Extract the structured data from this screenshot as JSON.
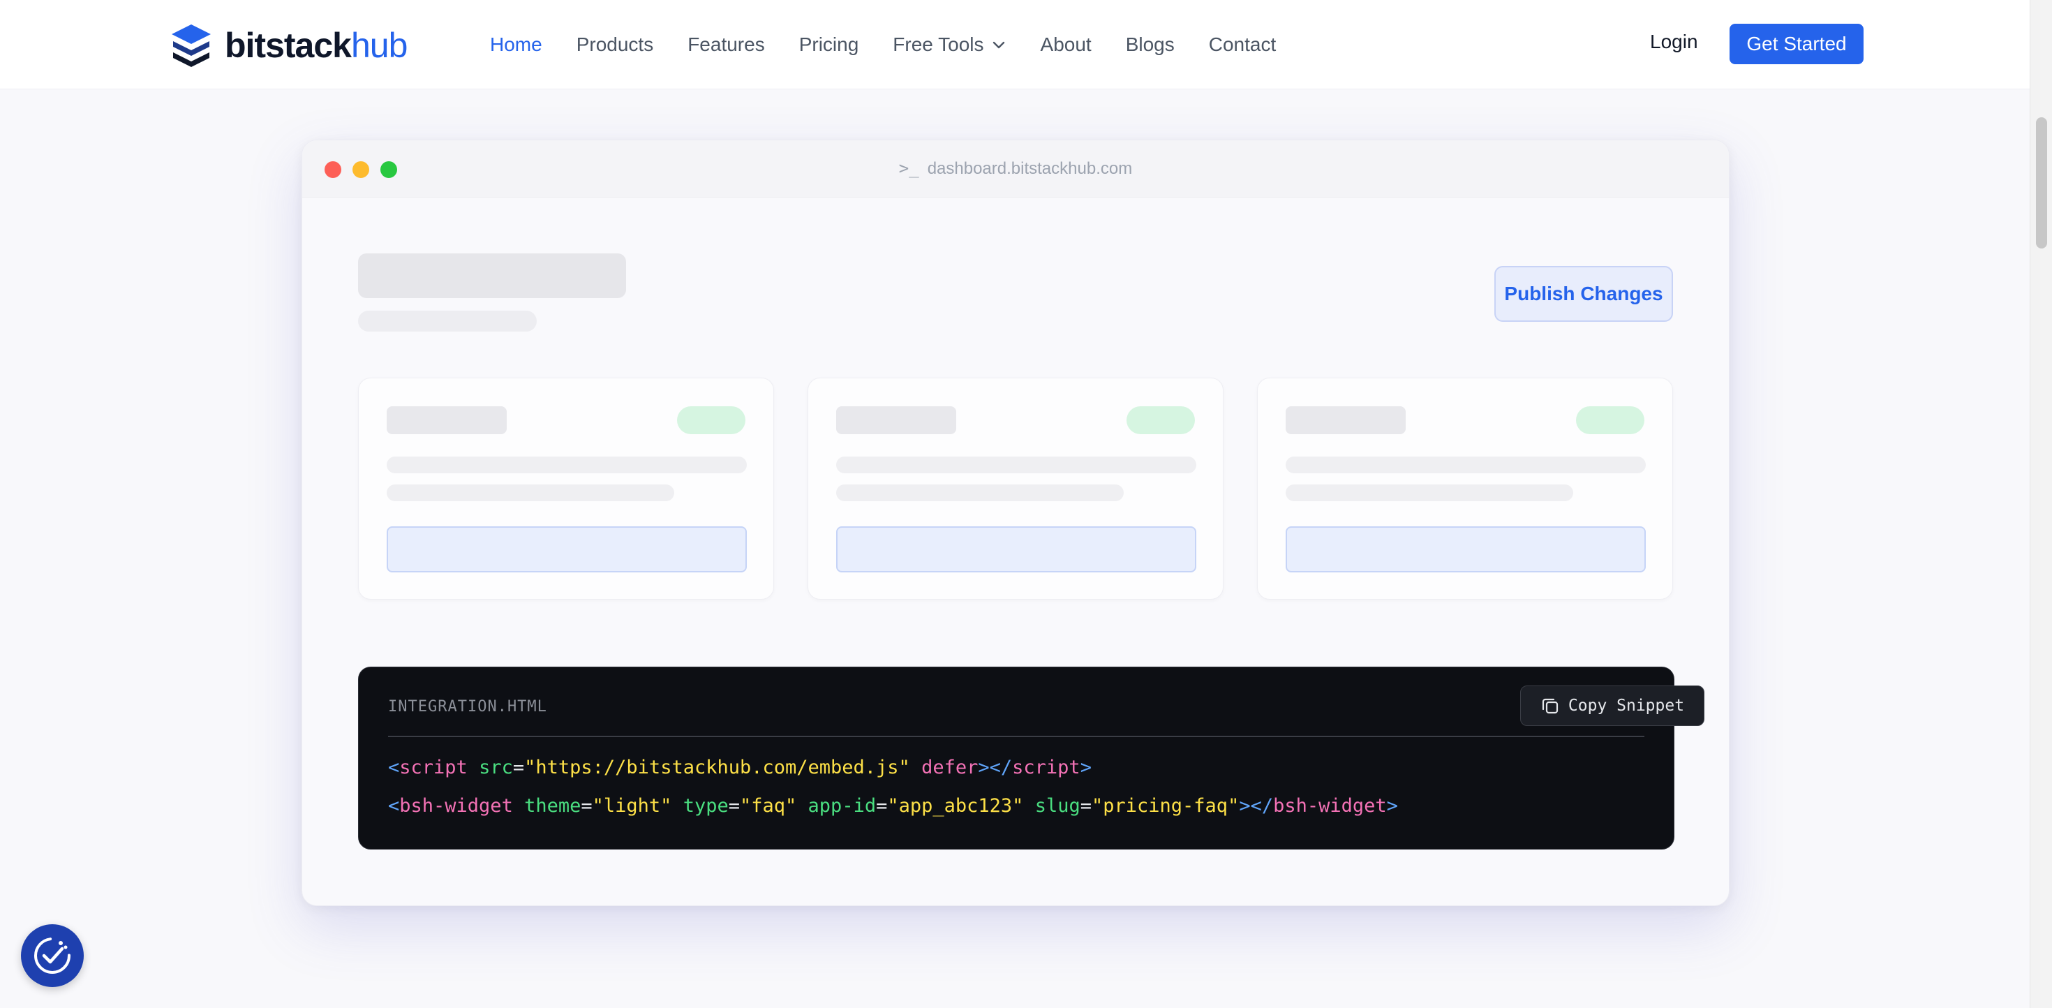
{
  "brand": {
    "name_main": "bitstack",
    "name_accent": "hub",
    "accent_color": "#2563eb"
  },
  "nav": {
    "links": [
      {
        "label": "Home",
        "active": true
      },
      {
        "label": "Products"
      },
      {
        "label": "Features"
      },
      {
        "label": "Pricing"
      },
      {
        "label": "Free Tools",
        "has_dropdown": true
      },
      {
        "label": "About"
      },
      {
        "label": "Blogs"
      },
      {
        "label": "Contact"
      }
    ],
    "login": "Login",
    "cta": "Get Started"
  },
  "window": {
    "url": "dashboard.bitstackhub.com",
    "publish_label": "Publish Changes",
    "code": {
      "filename": "INTEGRATION.HTML",
      "copy_label": "Copy Snippet",
      "line1": {
        "open": "<",
        "tag": "script",
        "attr1": "src",
        "eq": "=",
        "val1": "\"https://bitstackhub.com/embed.js\"",
        "attr2": "defer",
        "close_open": "></",
        "close_tag": "script",
        "end": ">"
      },
      "line2": {
        "open": "<",
        "tag": "bsh-widget",
        "a1": "theme",
        "v1": "\"light\"",
        "a2": "type",
        "v2": "\"faq\"",
        "a3": "app-id",
        "v3": "\"app_abc123\"",
        "a4": "slug",
        "v4": "\"pricing-faq\"",
        "close_open": "></",
        "close_tag": "bsh-widget",
        "end": ">"
      }
    }
  }
}
